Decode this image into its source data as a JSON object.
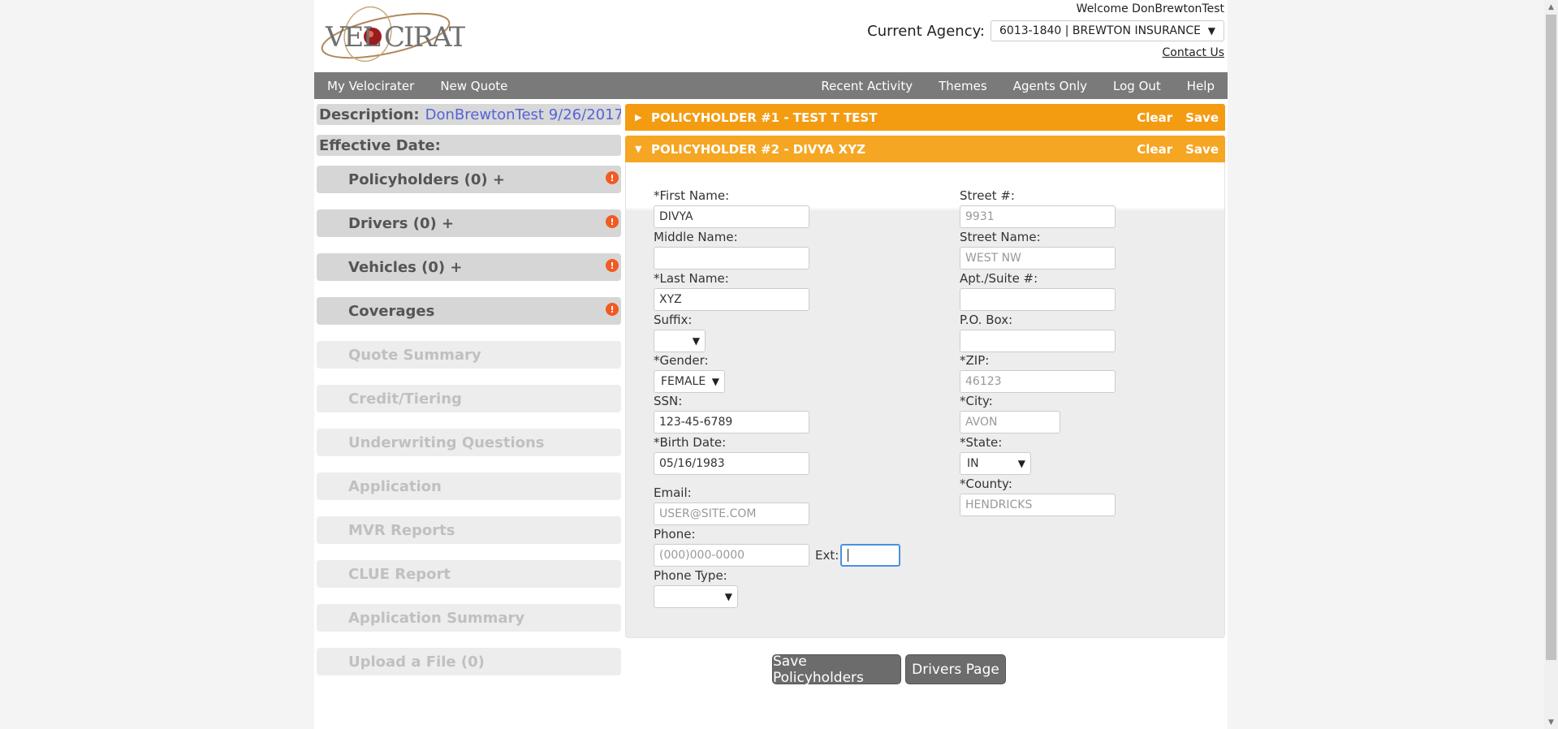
{
  "header": {
    "logo_text": "VELOCIRATER",
    "welcome": "Welcome DonBrewtonTest",
    "agency_label": "Current Agency:",
    "agency_value": "6013-1840 | BREWTON INSURANCE",
    "contact": "Contact Us"
  },
  "nav": {
    "left": [
      "My Velocirater",
      "New Quote"
    ],
    "right": [
      "Recent Activity",
      "Themes",
      "Agents Only",
      "Log Out",
      "Help"
    ]
  },
  "sidebar": {
    "description_label": "Description:",
    "description_value": "DonBrewtonTest 9/26/2017 ...",
    "effective_label": "Effective Date:",
    "items": [
      {
        "label": "Policyholders (0) +",
        "state": "active",
        "alert": true
      },
      {
        "label": "Drivers (0) +",
        "state": "active",
        "alert": true
      },
      {
        "label": "Vehicles (0) +",
        "state": "active",
        "alert": true
      },
      {
        "label": "Coverages",
        "state": "active",
        "alert": true
      },
      {
        "label": "Quote Summary",
        "state": "disabled",
        "alert": false
      },
      {
        "label": "Credit/Tiering",
        "state": "disabled",
        "alert": false
      },
      {
        "label": "Underwriting Questions",
        "state": "disabled",
        "alert": false
      },
      {
        "label": "Application",
        "state": "disabled",
        "alert": false
      },
      {
        "label": "MVR Reports",
        "state": "disabled",
        "alert": false
      },
      {
        "label": "CLUE Report",
        "state": "disabled",
        "alert": false
      },
      {
        "label": "Application Summary",
        "state": "disabled",
        "alert": false
      },
      {
        "label": "Upload a File (0)",
        "state": "disabled",
        "alert": false
      }
    ],
    "alert_glyph": "!"
  },
  "policyholders": {
    "bar1_title": "POLICYHOLDER #1 - TEST T TEST",
    "bar2_title": "POLICYHOLDER #2 - DIVYA XYZ",
    "clear": "Clear",
    "save": "Save"
  },
  "form": {
    "first_name_label": "*First Name:",
    "first_name": "DIVYA",
    "middle_name_label": "Middle Name:",
    "middle_name": "",
    "last_name_label": "*Last Name:",
    "last_name": "XYZ",
    "suffix_label": "Suffix:",
    "suffix": "",
    "gender_label": "*Gender:",
    "gender": "FEMALE",
    "ssn_label": "SSN:",
    "ssn": "123-45-6789",
    "birth_label": "*Birth Date:",
    "birth": "05/16/1983",
    "email_label": "Email:",
    "email_placeholder": "USER@SITE.COM",
    "phone_label": "Phone:",
    "phone_placeholder": "(000)000-0000",
    "ext_label": "Ext:",
    "ext": "",
    "phone_type_label": "Phone Type:",
    "phone_type": "",
    "street_num_label": "Street #:",
    "street_num": "9931",
    "street_name_label": "Street Name:",
    "street_name": "WEST NW",
    "apt_label": "Apt./Suite #:",
    "apt": "",
    "po_label": "P.O. Box:",
    "po": "",
    "zip_label": "*ZIP:",
    "zip": "46123",
    "city_label": "*City:",
    "city": "AVON",
    "state_label": "*State:",
    "state": "IN",
    "county_label": "*County:",
    "county": "HENDRICKS"
  },
  "buttons": {
    "save_policyholders": "Save Policyholders",
    "drivers_page": "Drivers Page"
  },
  "colors": {
    "accent_orange": "#f39c12",
    "nav_gray": "#7a7a7a",
    "alert_orange": "#f15a22",
    "link_blue": "#5563d8"
  }
}
